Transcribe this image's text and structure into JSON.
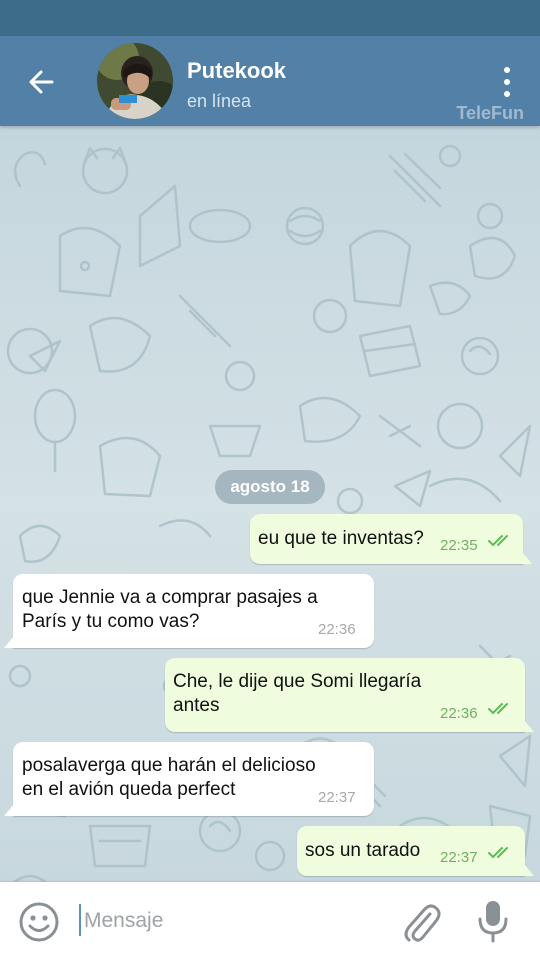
{
  "header": {
    "title": "Putekook",
    "status": "en línea",
    "watermark": "TeleFun",
    "back_icon": "arrow-left-icon",
    "menu_icon": "more-vertical-icon"
  },
  "chat": {
    "date_label": "agosto 18",
    "messages": [
      {
        "direction": "out",
        "text": "eu que te inventas?",
        "time": "22:35",
        "status": "read"
      },
      {
        "direction": "in",
        "text_lines": [
          "que Jennie va a comprar pasajes a",
          "París y tu como vas?"
        ],
        "time": "22:36"
      },
      {
        "direction": "out",
        "text_lines": [
          "Che, le dije que Somi llegaría",
          "antes"
        ],
        "time": "22:36",
        "status": "read"
      },
      {
        "direction": "in",
        "text_lines": [
          "posalaverga que harán el delicioso",
          "en el avión queda perfect"
        ],
        "time": "22:37"
      },
      {
        "direction": "out",
        "text": "sos un tarado",
        "time": "22:37",
        "status": "read"
      }
    ]
  },
  "composer": {
    "placeholder": "Mensaje",
    "emoji_icon": "smiley-icon",
    "attach_icon": "paperclip-icon",
    "mic_icon": "microphone-icon"
  },
  "colors": {
    "header": "#5280a6",
    "statusbar": "#3d6b8a",
    "outgoing_bubble": "#effdde",
    "incoming_bubble": "#ffffff",
    "read_ticks": "#5ebd57"
  }
}
